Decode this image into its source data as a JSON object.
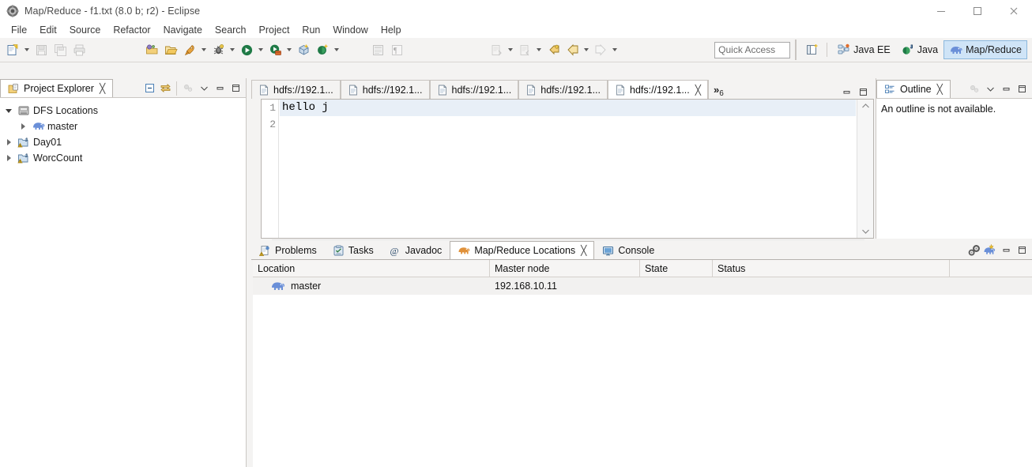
{
  "window": {
    "title": "Map/Reduce - f1.txt (8.0 b; r2) - Eclipse",
    "app_icon": "eclipse-icon",
    "minimize_label": "—",
    "maximize_label": "□",
    "close_label": "✕"
  },
  "menubar": {
    "items": [
      {
        "label": "File"
      },
      {
        "label": "Edit"
      },
      {
        "label": "Source"
      },
      {
        "label": "Refactor"
      },
      {
        "label": "Navigate"
      },
      {
        "label": "Search"
      },
      {
        "label": "Project"
      },
      {
        "label": "Run"
      },
      {
        "label": "Window"
      },
      {
        "label": "Help"
      }
    ]
  },
  "toolbar": {
    "quick_access_placeholder": "Quick Access",
    "new_wizard_icon": "new-wizard-icon",
    "save_icon": "save-icon",
    "save_all_icon": "save-all-icon",
    "print_icon": "print-icon",
    "open_type_icon": "open-type-icon",
    "open_resource_icon": "open-resource-icon",
    "run_external_icon": "external-tools-icon",
    "debug_icon": "debug-icon",
    "run_icon": "run-icon",
    "coverage_icon": "coverage-icon",
    "new_java_package_icon": "new-package-icon",
    "new_java_class_icon": "new-class-icon",
    "toggle_breadcrumb_icon": "breadcrumb-icon",
    "toggle_mark_occurrences_icon": "mark-occurrences-icon",
    "next_annotation_icon": "next-annotation-icon",
    "previous_annotation_icon": "previous-annotation-icon",
    "last_edit_icon": "last-edit-location-icon",
    "back_icon": "back-icon",
    "forward_icon": "forward-icon",
    "open_perspective_icon": "open-perspective-icon",
    "perspectives": [
      {
        "label": "Java EE",
        "icon": "java-ee-perspective-icon",
        "active": false
      },
      {
        "label": "Java",
        "icon": "java-perspective-icon",
        "active": false
      },
      {
        "label": "Map/Reduce",
        "icon": "mapreduce-perspective-icon",
        "active": true
      }
    ]
  },
  "project_explorer": {
    "title": "Project Explorer",
    "icon": "project-explorer-icon",
    "close_glyph": "╳",
    "tools": {
      "collapse_all_icon": "collapse-all-icon",
      "link_with_editor_icon": "link-with-editor-icon",
      "view_menu_icon": "view-menu-icon",
      "chevron_down_icon": "chevron-down-icon",
      "minimize_icon": "minimize-icon",
      "maximize_icon": "maximize-icon"
    },
    "tree": [
      {
        "label": "DFS Locations",
        "icon": "dfs-locations-icon",
        "expander": "caret-down",
        "indent": 0
      },
      {
        "label": "master",
        "icon": "elephant-icon",
        "expander": "caret-right",
        "indent": 1
      },
      {
        "label": "Day01",
        "icon": "java-project-warning-icon",
        "expander": "caret-right",
        "indent": 0
      },
      {
        "label": "WorcCount",
        "icon": "java-project-warning-icon",
        "expander": "caret-right",
        "indent": 0
      }
    ]
  },
  "editor": {
    "tabs": [
      {
        "label": "hdfs://192.1...",
        "icon": "text-file-icon",
        "active": false,
        "closable": false
      },
      {
        "label": "hdfs://192.1...",
        "icon": "text-file-icon",
        "active": false,
        "closable": false
      },
      {
        "label": "hdfs://192.1...",
        "icon": "text-file-icon",
        "active": false,
        "closable": false
      },
      {
        "label": "hdfs://192.1...",
        "icon": "text-file-icon",
        "active": false,
        "closable": false
      },
      {
        "label": "hdfs://192.1...",
        "icon": "text-file-icon",
        "active": true,
        "closable": true
      }
    ],
    "close_glyph": "╳",
    "overflow_chevron": "»",
    "overflow_count": "6",
    "tools": {
      "minimize_icon": "minimize-icon",
      "maximize_icon": "maximize-icon"
    },
    "lines": [
      {
        "number": "1",
        "text": "hello j",
        "current": true
      },
      {
        "number": "2",
        "text": "",
        "current": false
      }
    ],
    "scroll": {
      "up_glyph": "∧",
      "down_glyph": "∨",
      "left_glyph": "‹",
      "right_glyph": "›"
    }
  },
  "outline": {
    "title": "Outline",
    "icon": "outline-icon",
    "close_glyph": "╳",
    "message": "An outline is not available.",
    "tools": {
      "view_menu_icon": "view-menu-icon",
      "chevron_down_icon": "chevron-down-icon",
      "minimize_icon": "minimize-icon",
      "maximize_icon": "maximize-icon"
    }
  },
  "bottom_view": {
    "tabs": [
      {
        "label": "Problems",
        "icon": "problems-icon",
        "active": false,
        "closable": false
      },
      {
        "label": "Tasks",
        "icon": "tasks-icon",
        "active": false,
        "closable": false
      },
      {
        "label": "Javadoc",
        "icon": "javadoc-icon",
        "active": false,
        "closable": false
      },
      {
        "label": "Map/Reduce Locations",
        "icon": "mapreduce-locations-icon",
        "active": true,
        "closable": true
      },
      {
        "label": "Console",
        "icon": "console-icon",
        "active": false,
        "closable": false
      }
    ],
    "close_glyph": "╳",
    "tools": {
      "edit_location_icon": "edit-hadoop-location-icon",
      "new_location_icon": "new-hadoop-location-icon",
      "minimize_icon": "minimize-icon",
      "maximize_icon": "maximize-icon"
    },
    "table": {
      "columns": [
        "Location",
        "Master node",
        "State",
        "Status"
      ],
      "rows": [
        {
          "location": "master",
          "location_icon": "elephant-icon",
          "master_node": "192.168.10.11",
          "state": "",
          "status": ""
        }
      ]
    }
  },
  "colors": {
    "accent_blue": "#cfe4f7",
    "panel_bg": "#f4f3f2",
    "editor_bg": "#ffffff",
    "current_line": "#e8eff7",
    "elephant_blue": "#6a8fd8",
    "row_bg": "#f2f1f0"
  }
}
